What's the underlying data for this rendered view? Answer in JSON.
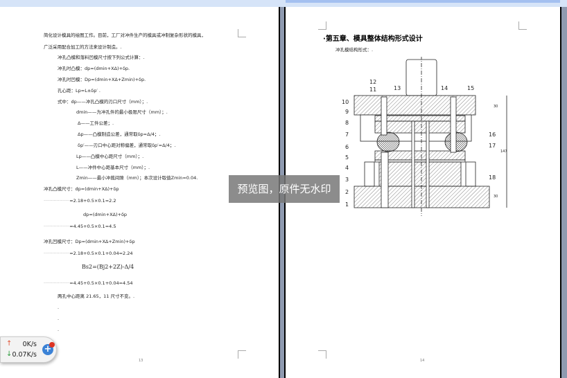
{
  "watermark": "预览图，原件无水印",
  "page_left": {
    "page_number": "13",
    "lines": [
      "简化设计模具的绘图工作。目前，工厂对冲件生产的模具或冲制复杂形状的模具，",
      "广泛采用配合加工的方法来设计制造。.",
      "冲孔凸模和落料凹模尺寸按下列公式计算：.",
      "冲孔时凸模：dp=(dmin+XΔ)+δp.",
      "冲孔时凹模：Dp=(dmin+XΔ+Zmin)+δp.",
      "孔心距：Lp=L±δp′ .",
      "式中：dp——冲孔凸模的刃口尺寸（mm）；.",
      "dmin——为冲孔件的最小极限尺寸（mm）；.",
      "Δ——工件公差；.",
      "Δp——凸模制造公差，通常取δp=Δ/4；.",
      "δp′——刃口中心距对称偏差，通常取δp′=Δ/4；.",
      "Lp——凸模中心距尺寸（mm）；.",
      "L——冲件中心距基本尺寸（mm）；.",
      "Zmin——最小冲裁间隙（mm）；本次设计取值Zmin=0.04.",
      "冲孔凸模尺寸：dp=(dmin+XΔ)+δp",
      "=2.18+0.5×0.1=2.2",
      "dp=(dmin+XΔ)+δp",
      "=4.45+0.5×0.1=4.5",
      "冲孔凹模尺寸：Dp=(dmin+XΔ+Zmin)+δp",
      "=2.18+0.5×0.1+0.04=2.24",
      "Bs2=(Bj2+2Z)-Δ/4",
      "=4.45+0.5×0.1+0.04=4.54",
      "两孔中心距离 21.65，11 尺寸不变。.",
      ".",
      ".",
      "."
    ]
  },
  "page_right": {
    "page_number": "14",
    "heading": "第五章、模具整体结构形式设计",
    "subheading": "冲孔模结构形式：.",
    "figure_labels": [
      "1",
      "2",
      "3",
      "4",
      "5",
      "6",
      "7",
      "8",
      "9",
      "10",
      "11",
      "12",
      "13",
      "14",
      "15",
      "16",
      "17",
      "18"
    ],
    "dimensions": [
      "30",
      "147",
      "30"
    ]
  },
  "net_widget": {
    "upload": "0K/s",
    "download": "0.07K/s",
    "upload_arrow": "↑",
    "download_arrow": "↓"
  }
}
